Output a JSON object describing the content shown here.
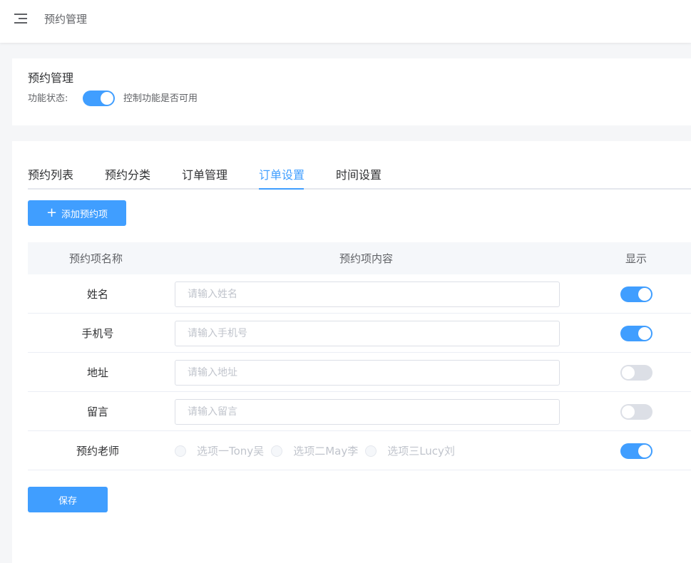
{
  "header": {
    "breadcrumb": "预约管理"
  },
  "feature": {
    "title": "预约管理",
    "status_label": "功能状态:",
    "enabled": true,
    "hint": "控制功能是否可用"
  },
  "tabs": [
    {
      "label": "预约列表",
      "active": false
    },
    {
      "label": "预约分类",
      "active": false
    },
    {
      "label": "订单管理",
      "active": false
    },
    {
      "label": "订单设置",
      "active": true
    },
    {
      "label": "时间设置",
      "active": false
    }
  ],
  "add_button": {
    "label": "添加预约项",
    "icon": "plus-icon"
  },
  "table": {
    "headers": {
      "name": "预约项名称",
      "content": "预约项内容",
      "display": "显示"
    },
    "rows": [
      {
        "name": "姓名",
        "placeholder": "请输入姓名",
        "value": "",
        "show": true
      },
      {
        "name": "手机号",
        "placeholder": "请输入手机号",
        "value": "",
        "show": true
      },
      {
        "name": "地址",
        "placeholder": "请输入地址",
        "value": "",
        "show": false
      },
      {
        "name": "留言",
        "placeholder": "请输入留言",
        "value": "",
        "show": false
      }
    ],
    "teacher_row": {
      "name": "预约老师",
      "options": [
        "选项一Tony吴",
        "选项二May李",
        "选项三Lucy刘"
      ],
      "show": true
    }
  },
  "save_button": {
    "label": "保存"
  },
  "colors": {
    "primary": "#409eff",
    "switch_off": "#dcdfe6",
    "page_bg": "#f5f6f8"
  }
}
